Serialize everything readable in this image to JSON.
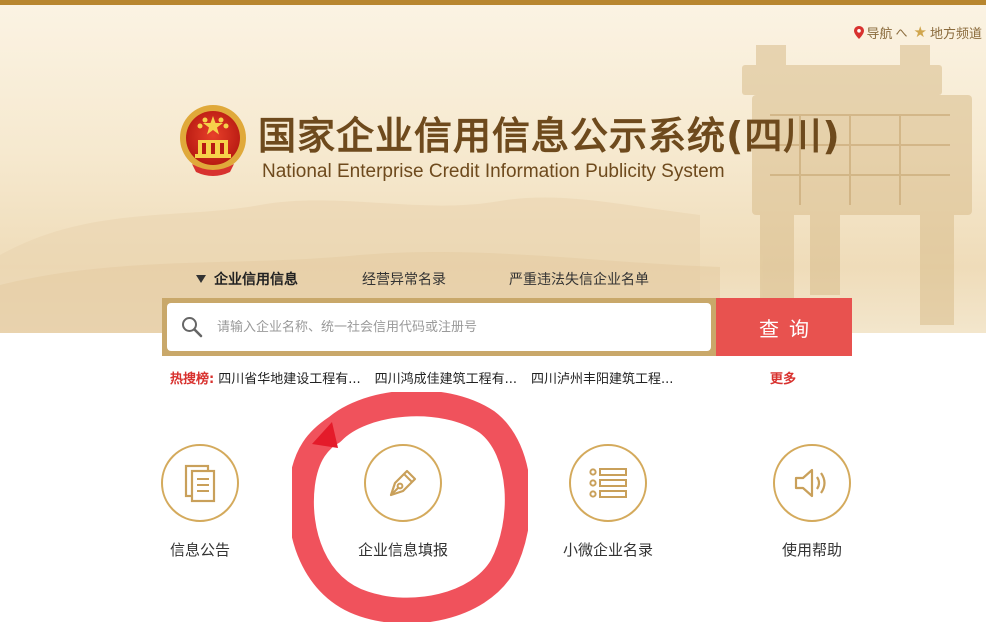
{
  "top_nav": {
    "nav_label": "导航",
    "nav_caret": "へ",
    "local_channel_label": "地方频道"
  },
  "header": {
    "title": "国家企业信用信息公示系统(四川)",
    "subtitle": "National Enterprise Credit Information Publicity System"
  },
  "search": {
    "tabs": [
      {
        "label": "企业信用信息",
        "active": true
      },
      {
        "label": "经营异常名录",
        "active": false
      },
      {
        "label": "严重违法失信企业名单",
        "active": false
      }
    ],
    "placeholder": "请输入企业名称、统一社会信用代码或注册号",
    "button_label": "查询"
  },
  "hot_search": {
    "label": "热搜榜:",
    "items": [
      "四川省华地建设工程有...",
      "四川鸿成佳建筑工程有...",
      "四川泸州丰阳建筑工程..."
    ],
    "more_label": "更多"
  },
  "features": [
    {
      "label": "信息公告",
      "icon": "document-icon"
    },
    {
      "label": "企业信息填报",
      "icon": "pen-nib-icon"
    },
    {
      "label": "小微企业名录",
      "icon": "list-icon"
    },
    {
      "label": "使用帮助",
      "icon": "speaker-icon"
    }
  ],
  "colors": {
    "accent_gold": "#c9a86a",
    "search_red": "#e8524f",
    "hot_red": "#d8322f",
    "title_brown": "#6e4a1d",
    "annotation_red": "#ee3a45"
  }
}
